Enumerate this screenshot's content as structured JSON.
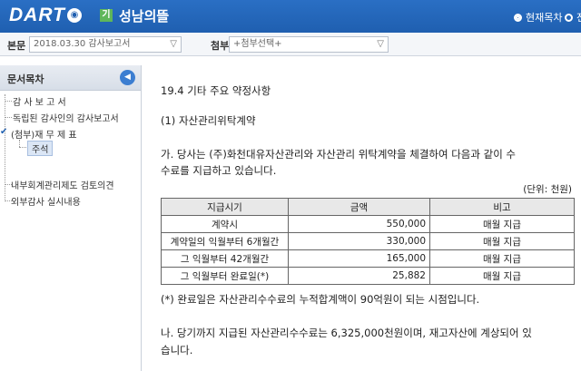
{
  "header": {
    "logo_text": "DART",
    "corp_badge": "기",
    "corp_name": "성남의뜰",
    "options": [
      "현재목차",
      "전"
    ]
  },
  "filters": {
    "main_label": "본문",
    "main_value": "2018.03.30  감사보고서",
    "attach_label": "첨부",
    "attach_value": "+첨부선택+"
  },
  "sidebar": {
    "title": "문서목차",
    "items": [
      {
        "label": "감 사 보 고 서"
      },
      {
        "label": "독립된 감사인의 감사보고서"
      },
      {
        "label": "(첨부)재 무 제 표"
      },
      {
        "label": "주석"
      },
      {
        "label": "내부회계관리제도 검토의견"
      },
      {
        "label": "외부감사 실시내용"
      }
    ]
  },
  "doc": {
    "section": "19.4 기타 주요 약정사항",
    "subsection": "(1) 자산관리위탁계약",
    "para_a_1": "가. 당사는 (주)화천대유자산관리와 자산관리 위탁계약을 체결하여 다음과 같이 수",
    "para_a_2": "수료를 지급하고 있습니다.",
    "unit": "(단위: 천원)",
    "table": {
      "headers": [
        "지급시기",
        "금액",
        "비고"
      ],
      "rows": [
        [
          "계약시",
          "550,000",
          "매월 지급"
        ],
        [
          "계약일의 익월부터 6개월간",
          "330,000",
          "매월 지급"
        ],
        [
          "그 익월부터 42개월간",
          "165,000",
          "매월 지급"
        ],
        [
          "그 익월부터 완료일(*)",
          "25,882",
          "매월 지급"
        ]
      ]
    },
    "footnote": "(*) 완료일은 자산관리수수료의 누적합계액이 90억원이 되는 시점입니다.",
    "para_b_1": "나. 당기까지 지급된 자산관리수수료는 6,325,000천원이며, 재고자산에 계상되어 있",
    "para_b_2": "습니다."
  }
}
